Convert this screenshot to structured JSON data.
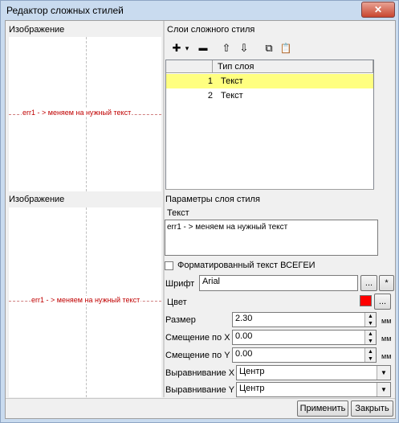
{
  "window": {
    "title": "Редактор сложных стилей",
    "close_glyph": "✕"
  },
  "top_preview": {
    "label": "Изображение",
    "sample_text": "err1 - > меняем на нужный текст"
  },
  "layers": {
    "label": "Слои сложного стиля",
    "toolbar": {
      "add": "✚",
      "add_dropdown": "▾",
      "remove": "▬",
      "up": "⇧",
      "down": "⇩",
      "copy": "⧉",
      "paste": "📋"
    },
    "column_header": "Тип слоя",
    "rows": [
      {
        "num": "1",
        "type": "Текст",
        "selected": true
      },
      {
        "num": "2",
        "type": "Текст",
        "selected": false
      }
    ]
  },
  "bottom_preview": {
    "label": "Изображение",
    "sample_text": "err1 - > меняем на нужный текст"
  },
  "params": {
    "label": "Параметры слоя стиля",
    "text_label": "Текст",
    "text_value": "err1 - > меняем на нужный текст",
    "formatted_checkbox": {
      "label": "Форматированный текст ВСЕГЕИ",
      "checked": false
    },
    "font": {
      "label": "Шрифт",
      "value": "Arial",
      "browse": "...",
      "star": "*"
    },
    "color": {
      "label": "Цвет",
      "value": "#ff0000",
      "browse": "..."
    },
    "size": {
      "label": "Размер",
      "value": "2.30",
      "unit": "мм"
    },
    "offset_x": {
      "label": "Смещение по X",
      "value": "0.00",
      "unit": "мм"
    },
    "offset_y": {
      "label": "Смещение по Y",
      "value": "0.00",
      "unit": "мм"
    },
    "align_x": {
      "label": "Выравнивание X",
      "value": "Центр"
    },
    "align_y": {
      "label": "Выравнивание Y",
      "value": "Центр"
    },
    "spin_up": "▲",
    "spin_down": "▼",
    "dropdown_arrow": "▼"
  },
  "footer": {
    "apply": "Применить",
    "close": "Закрыть"
  }
}
